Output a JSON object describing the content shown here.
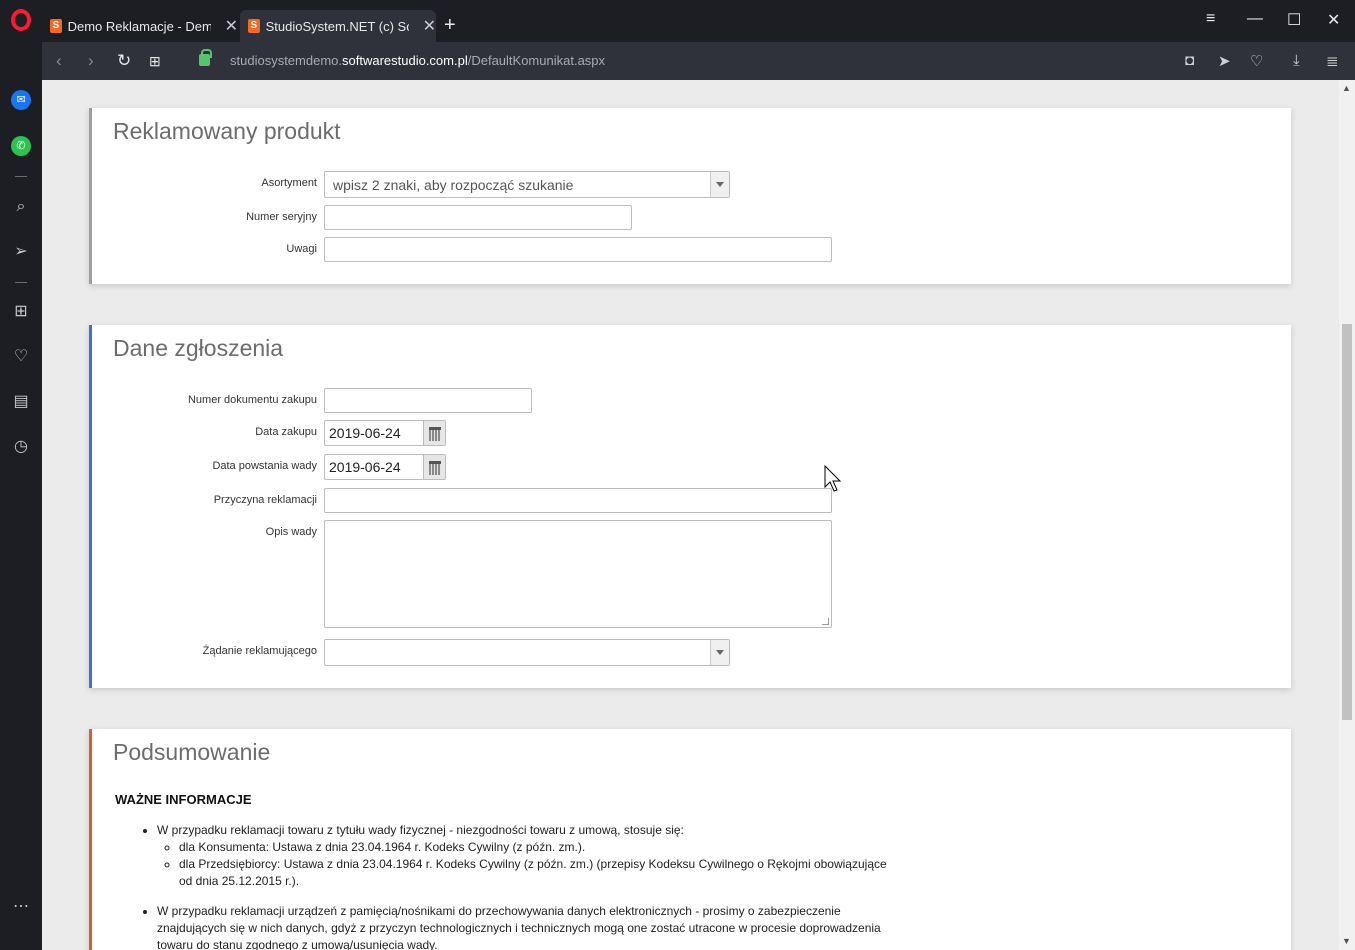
{
  "browser": {
    "tabs": [
      {
        "title": "Demo Reklamacje - Demo"
      },
      {
        "title": "StudioSystem.NET (c) Software"
      }
    ],
    "url_prefix": "studiosystemdemo.",
    "url_domain": "softwarestudio.com.pl",
    "url_path": "/DefaultKomunikat.aspx"
  },
  "sections": {
    "product": {
      "title": "Reklamowany produkt",
      "asortyment_label": "Asortyment",
      "asortyment_placeholder": "wpisz 2 znaki, aby rozpocząć szukanie",
      "serial_label": "Numer seryjny",
      "serial_value": "",
      "notes_label": "Uwagi",
      "notes_value": ""
    },
    "claim": {
      "title": "Dane zgłoszenia",
      "doc_label": "Numer dokumentu zakupu",
      "doc_value": "",
      "purchase_date_label": "Data zakupu",
      "purchase_date_value": "2019-06-24",
      "defect_date_label": "Data powstania wady",
      "defect_date_value": "2019-06-24",
      "reason_label": "Przyczyna reklamacji",
      "reason_value": "",
      "description_label": "Opis wady",
      "request_label": "Żądanie reklamującego",
      "request_value": ""
    },
    "summary": {
      "title": "Podsumowanie",
      "heading": "WAŻNE INFORMACJE",
      "item1": "W przypadku reklamacji towaru z tytułu wady fizycznej - niezgodności towaru z umową, stosuje się:",
      "item1_sub1": "dla Konsumenta: Ustawa z dnia 23.04.1964 r. Kodeks Cywilny (z późn. zm.).",
      "item1_sub2": "dla Przedsiębiorcy: Ustawa z dnia 23.04.1964 r. Kodeks Cywilny (z późn. zm.) (przepisy Kodeksu Cywilnego o Rękojmi obowiązujące od dnia 25.12.2015 r.).",
      "item2": "W przypadku reklamacji urządzeń z pamięcią/nośnikami do przechowywania danych elektronicznych - prosimy o zabezpieczenie znajdujących się w nich danych, gdyż z przyczyn technologicznych i technicznych mogą one zostać utracone w procesie doprowadzenia towaru do stanu zgodnego z umową/usunięcia wady."
    }
  }
}
